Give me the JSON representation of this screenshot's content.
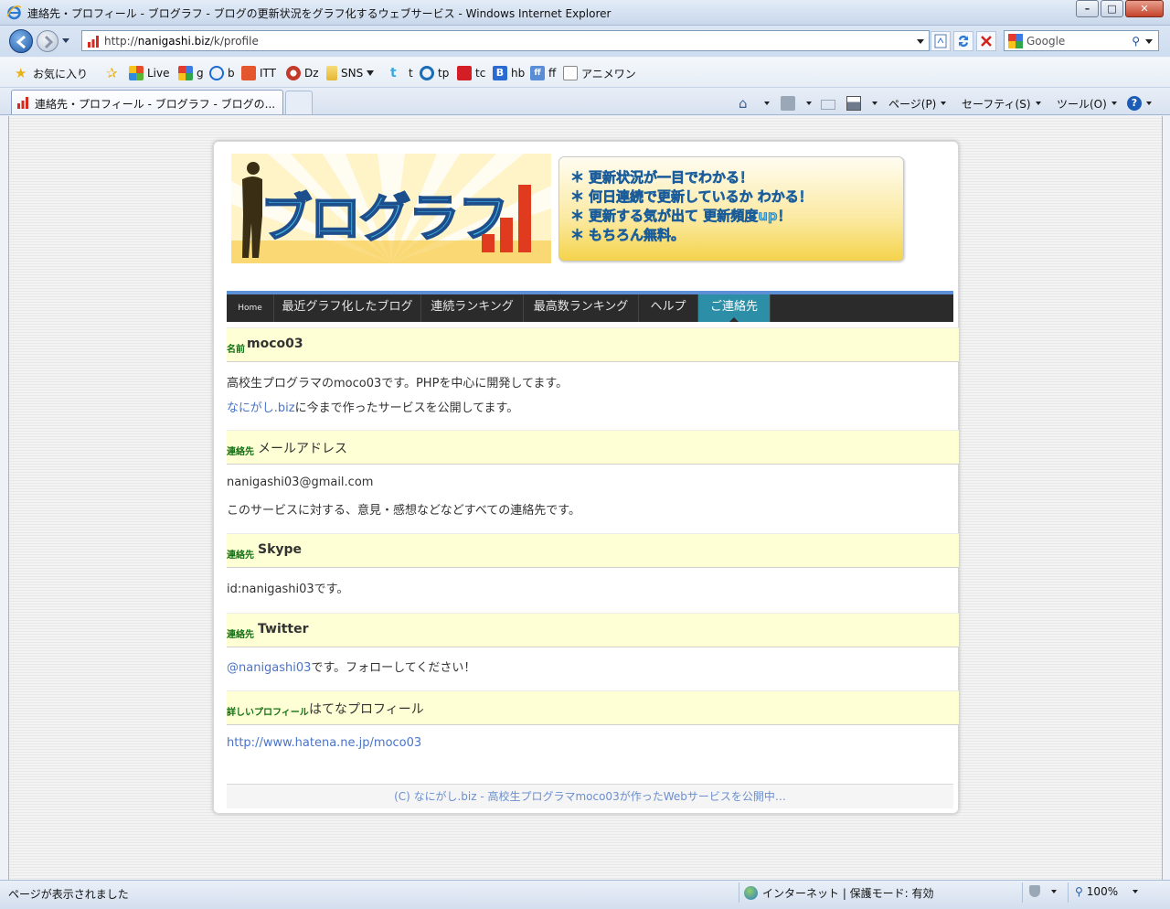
{
  "window": {
    "title": "連絡先・プロフィール - ブログラフ - ブログの更新状況をグラフ化するウェブサービス - Windows Internet Explorer"
  },
  "address": {
    "url_prefix": "http://",
    "url_host": "nanigashi.biz",
    "url_path": "/k/profile",
    "search_placeholder": "Google"
  },
  "favorites": {
    "label": "お気に入り",
    "items": [
      "Live",
      "g",
      "b",
      "ITT",
      "Dz",
      "SNS",
      "t",
      "tp",
      "tc",
      "hb",
      "ff",
      "アニメワン"
    ]
  },
  "tab": {
    "label": "連絡先・プロフィール - ブログラフ - ブログの..."
  },
  "commandbar": {
    "page": "ページ(P)",
    "safety": "セーフティ(S)",
    "tools": "ツール(O)"
  },
  "site": {
    "logo_text": "ブログラフ",
    "taglines": [
      "更新状況が一目でわかる！",
      "何日連続で更新しているか わかる！",
      "更新する気が出て 更新頻度up！",
      "もちろん無料。"
    ],
    "nav": [
      "Home",
      "最近グラフ化したブログ",
      "連続ランキング",
      "最高数ランキング",
      "ヘルプ",
      "ご連絡先"
    ],
    "sections": [
      {
        "kind": "名前",
        "title": "moco03",
        "lines": [
          {
            "text": "高校生プログラマのmoco03です。PHPを中心に開発してます。"
          },
          {
            "link": "なにがし.biz",
            "text": "に今まで作ったサービスを公開してます。"
          }
        ]
      },
      {
        "kind": "連絡先",
        "title": "メールアドレス",
        "lines": [
          {
            "text": "nanigashi03@gmail.com"
          },
          {
            "text": "このサービスに対する、意見・感想などなどすべての連絡先です。"
          }
        ]
      },
      {
        "kind": "連絡先",
        "title": "Skype",
        "lines": [
          {
            "text": "id:nanigashi03です。"
          }
        ]
      },
      {
        "kind": "連絡先",
        "title": "Twitter",
        "lines": [
          {
            "link": "@nanigashi03",
            "text": "です。フォローしてください！"
          }
        ]
      },
      {
        "kind": "詳しいプロフィール",
        "title": "はてなプロフィール",
        "lines": [
          {
            "link": "http://www.hatena.ne.jp/moco03"
          }
        ]
      }
    ],
    "footer": "(C) なにがし.biz - 高校生プログラマmoco03が作ったWebサービスを公開中…"
  },
  "status": {
    "message": "ページが表示されました",
    "zone": "インターネット | 保護モード: 有効",
    "zoom": "100%"
  },
  "colors": {
    "nav_active": "#2d8ea8",
    "nav_bg": "#2b2b2b",
    "section_bg": "#ffffd6",
    "link": "#4a73c9",
    "kind_label": "#147014"
  }
}
